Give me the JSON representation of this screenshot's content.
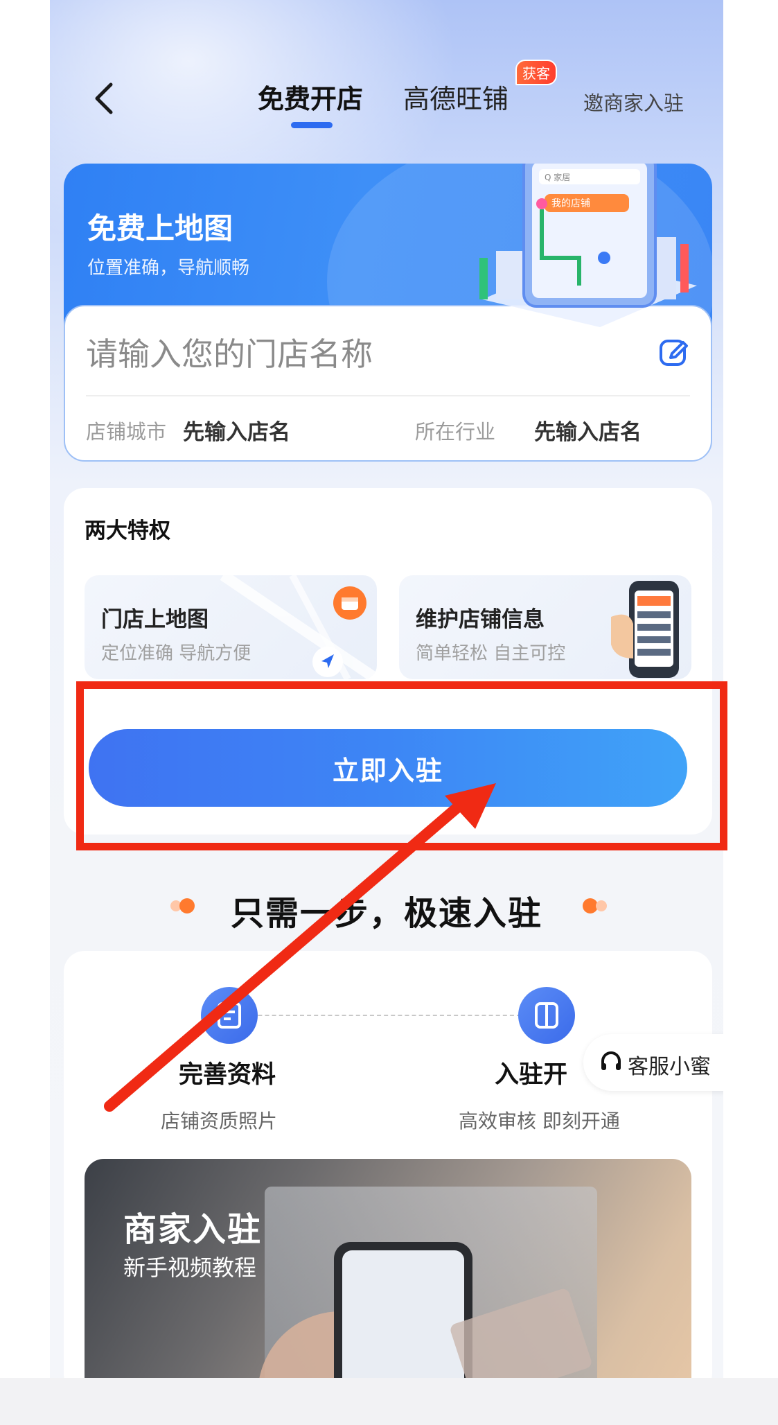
{
  "header": {
    "tabs": [
      {
        "label": "免费开店",
        "active": true
      },
      {
        "label": "高德旺铺",
        "active": false
      }
    ],
    "badge": "获客",
    "invite_label": "邀商家入驻"
  },
  "banner": {
    "title": "免费上地图",
    "subtitle": "位置准确，导航顺畅",
    "illustration_search_text": "Q 家居",
    "illustration_pin_label": "我的店铺"
  },
  "store_form": {
    "name_placeholder": "请输入您的门店名称",
    "city_label": "店铺城市",
    "city_value": "先输入店名",
    "industry_label": "所在行业",
    "industry_value": "先输入店名"
  },
  "privileges": {
    "title": "两大特权",
    "items": [
      {
        "title": "门店上地图",
        "subtitle": "定位准确 导航方便"
      },
      {
        "title": "维护店铺信息",
        "subtitle": "简单轻松 自主可控"
      }
    ],
    "cta_label": "立即入驻"
  },
  "steps_section": {
    "heading": "只需一步，极速入驻",
    "steps": [
      {
        "title": "完善资料",
        "subtitle": "店铺资质照片"
      },
      {
        "title": "入驻开",
        "subtitle": "高效审核 即刻开通"
      }
    ],
    "customer_service_label": "客服小蜜",
    "video": {
      "title": "商家入驻",
      "subtitle": "新手视频教程"
    }
  },
  "colors": {
    "accent": "#2d6bf0",
    "cta_start": "#3f73f2",
    "cta_end": "#40a3f8",
    "annotation_red": "#f02a14",
    "badge": "#ff4a33"
  },
  "icons": {
    "back": "chevron-left-icon",
    "edit": "edit-pencil-icon",
    "step1": "form-icon",
    "step2": "door-icon",
    "service": "headset-icon"
  }
}
